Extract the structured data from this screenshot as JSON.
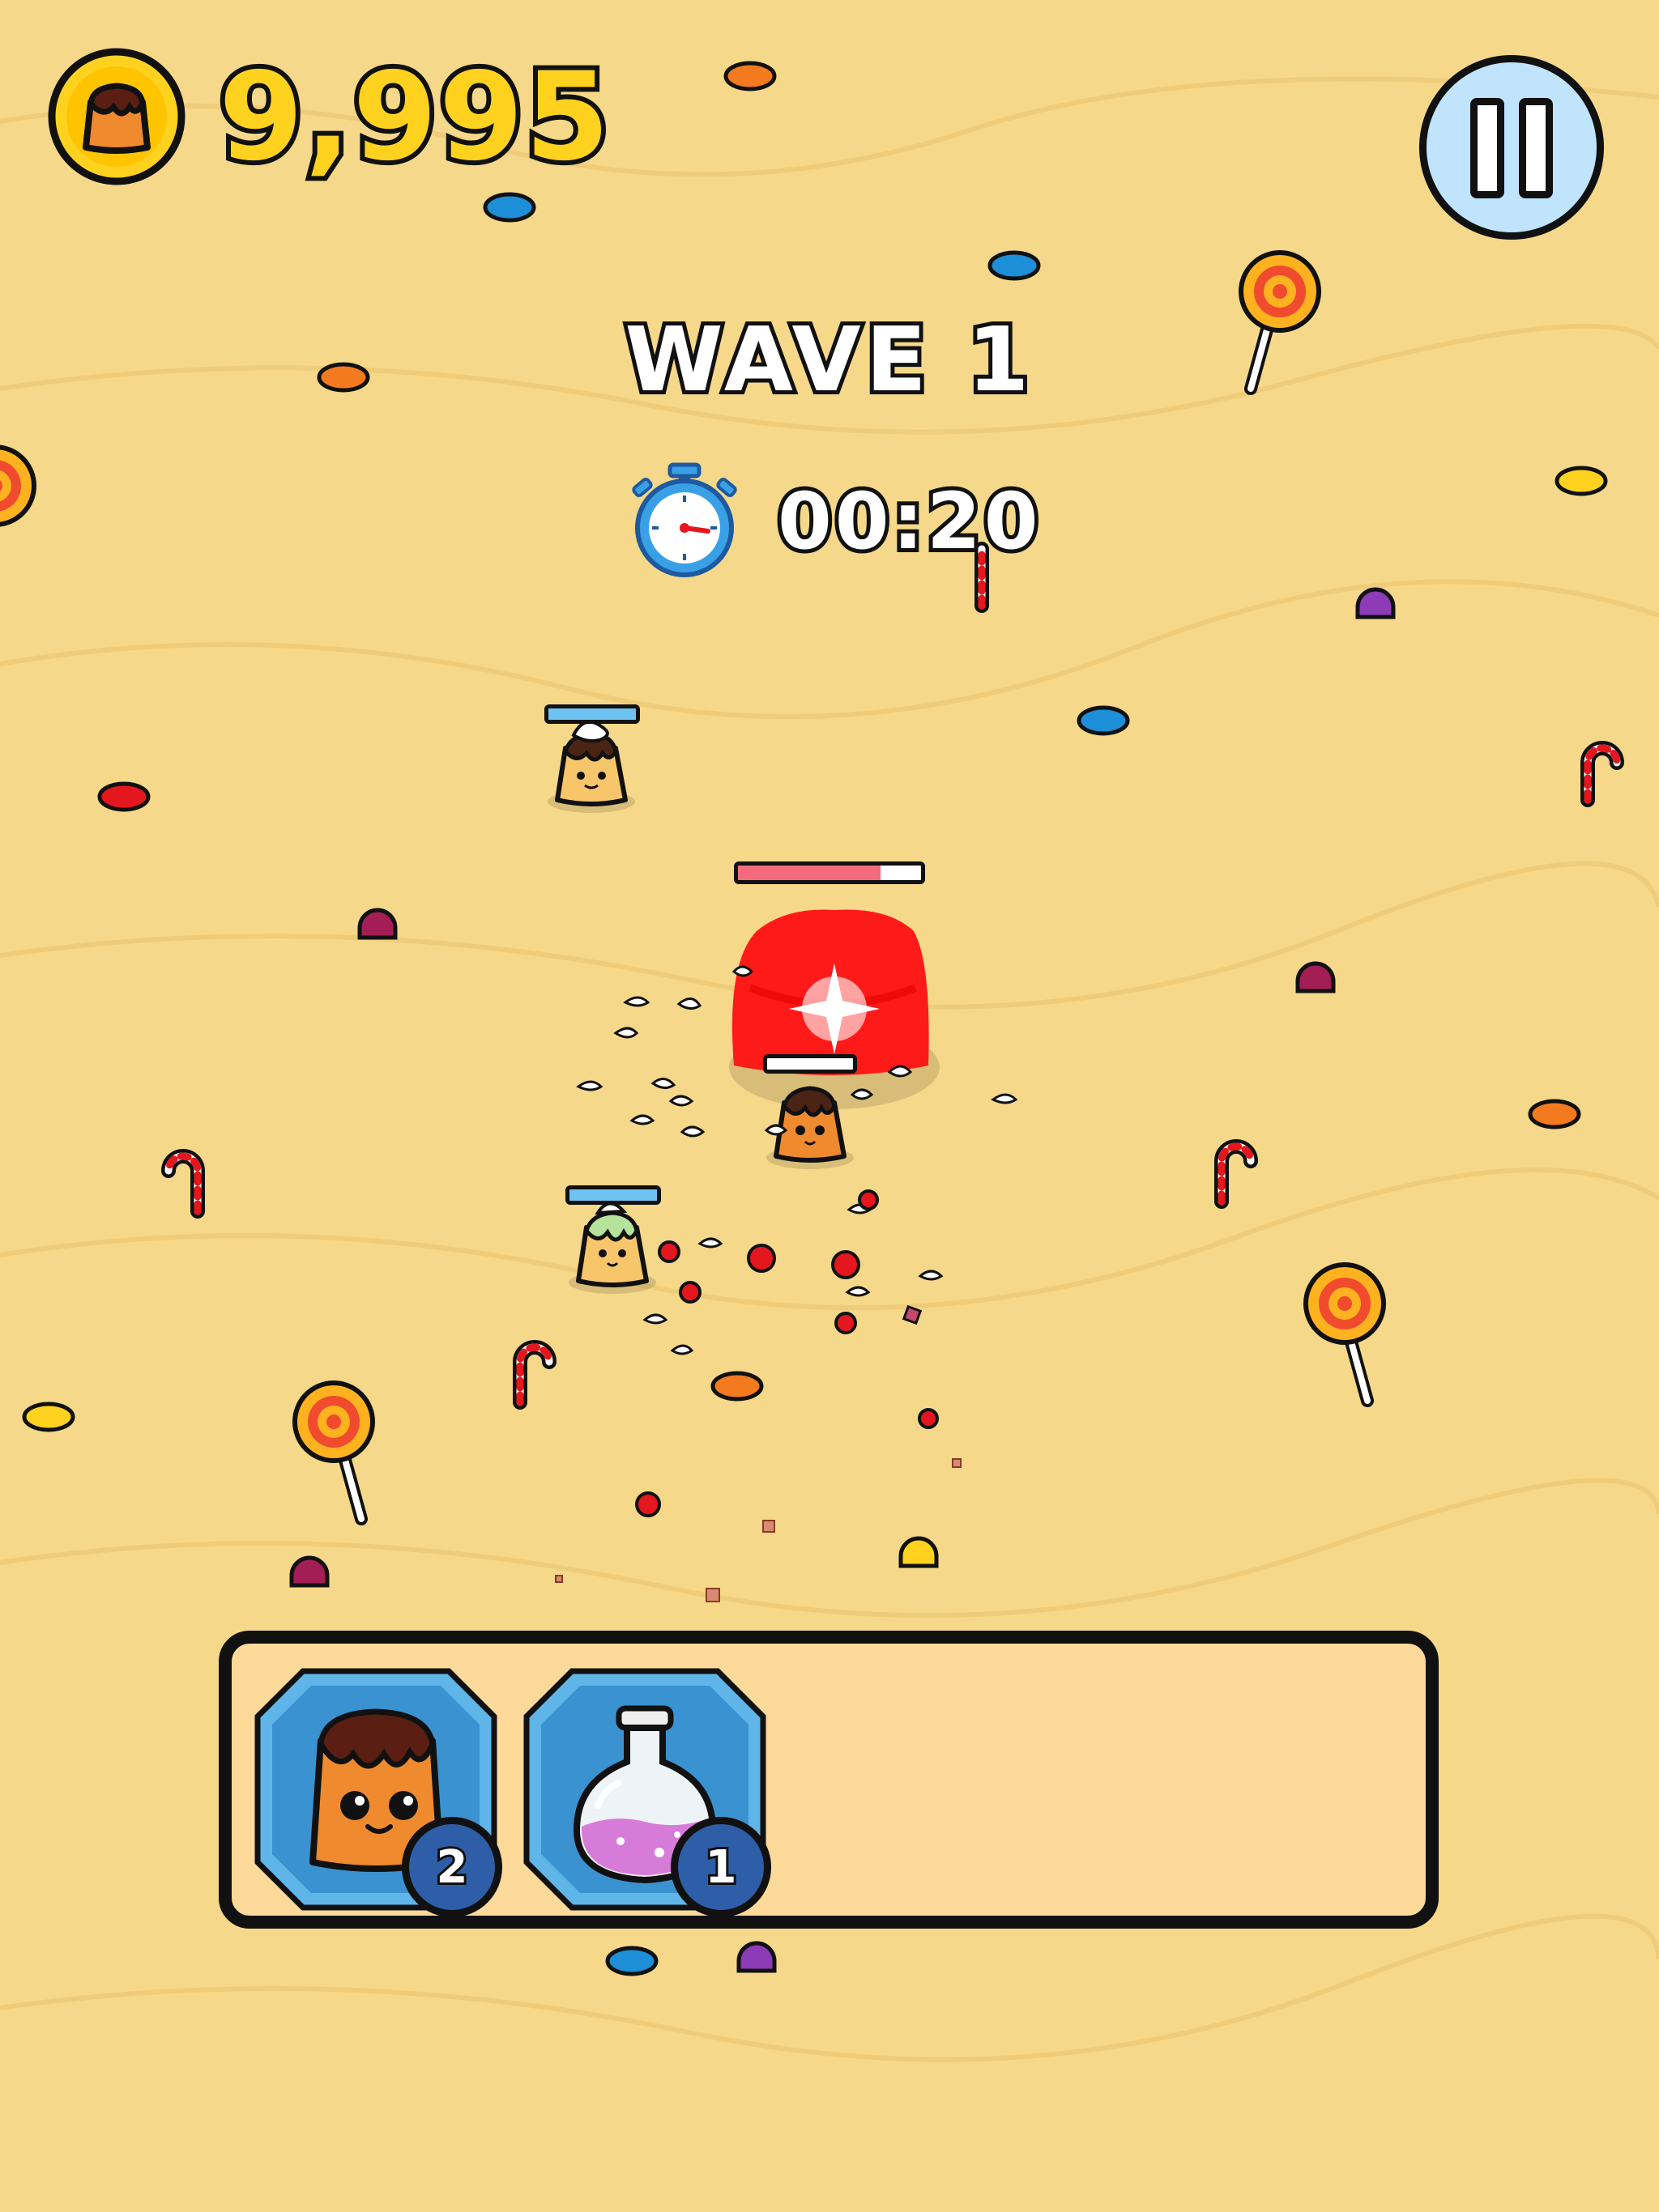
{
  "hud": {
    "coins": "9,995",
    "wave_label": "WAVE 1",
    "timer": "00:20"
  },
  "boss": {
    "health_fraction": 0.78
  },
  "enemies": [
    {
      "type": "cream-pudding",
      "health_fraction": 1.0
    },
    {
      "type": "matcha-pudding",
      "health_fraction": 1.0
    },
    {
      "type": "caramel-pudding",
      "health_fraction": 1.0
    }
  ],
  "inventory": [
    {
      "name": "pudding-ally",
      "count": "2"
    },
    {
      "name": "potion",
      "count": "1"
    }
  ],
  "colors": {
    "sand": "#f5d889",
    "coin_yellow": "#ffd21f",
    "slot_blue": "#5fb5e8",
    "badge_blue": "#2e5ea8",
    "boss_red": "#ff1a1a",
    "health_pink": "#f36b7c",
    "ally_health_blue": "#6fc3f0"
  }
}
